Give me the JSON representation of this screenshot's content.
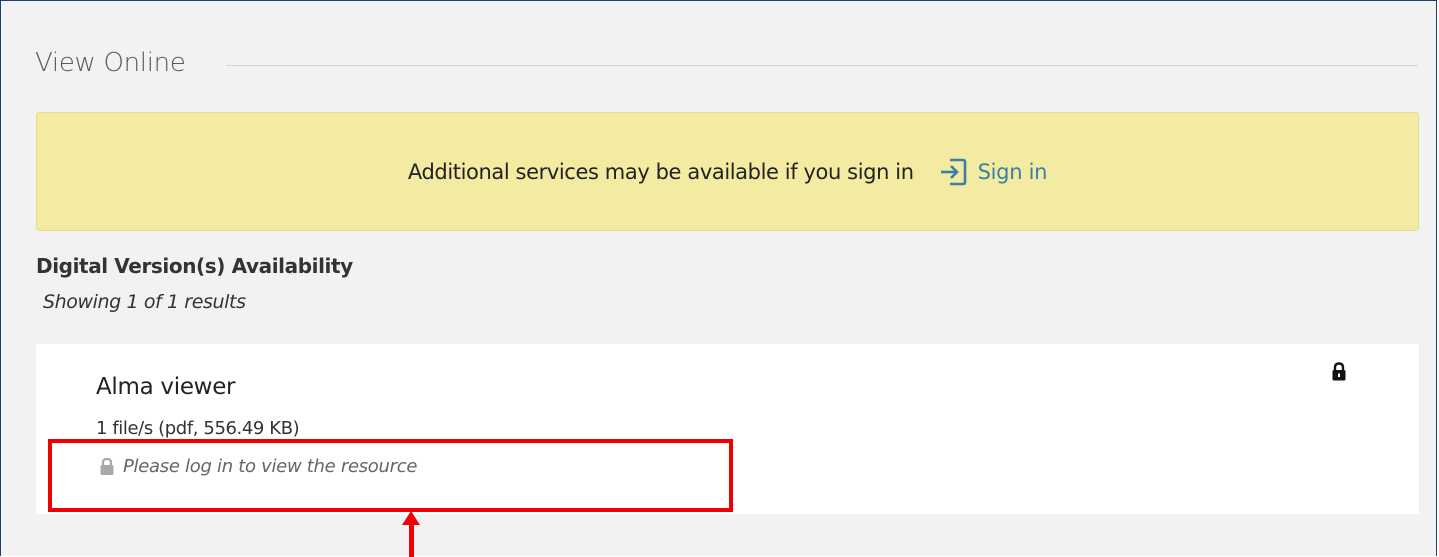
{
  "section": {
    "title": "View Online"
  },
  "banner": {
    "text": "Additional services may be available if you sign in",
    "signin_label": "Sign in",
    "signin_icon": "sign-in-icon"
  },
  "availability": {
    "heading": "Digital Version(s) Availability",
    "count": "Showing 1 of 1 results"
  },
  "result": {
    "title": "Alma viewer",
    "meta": "1 file/s (pdf, 556.49 KB)",
    "lock_icon": "lock-icon",
    "login_note": "Please log in to view the resource"
  },
  "colors": {
    "banner_bg": "#f3eba1",
    "link": "#3a7fa6",
    "annotation": "#f00000"
  }
}
